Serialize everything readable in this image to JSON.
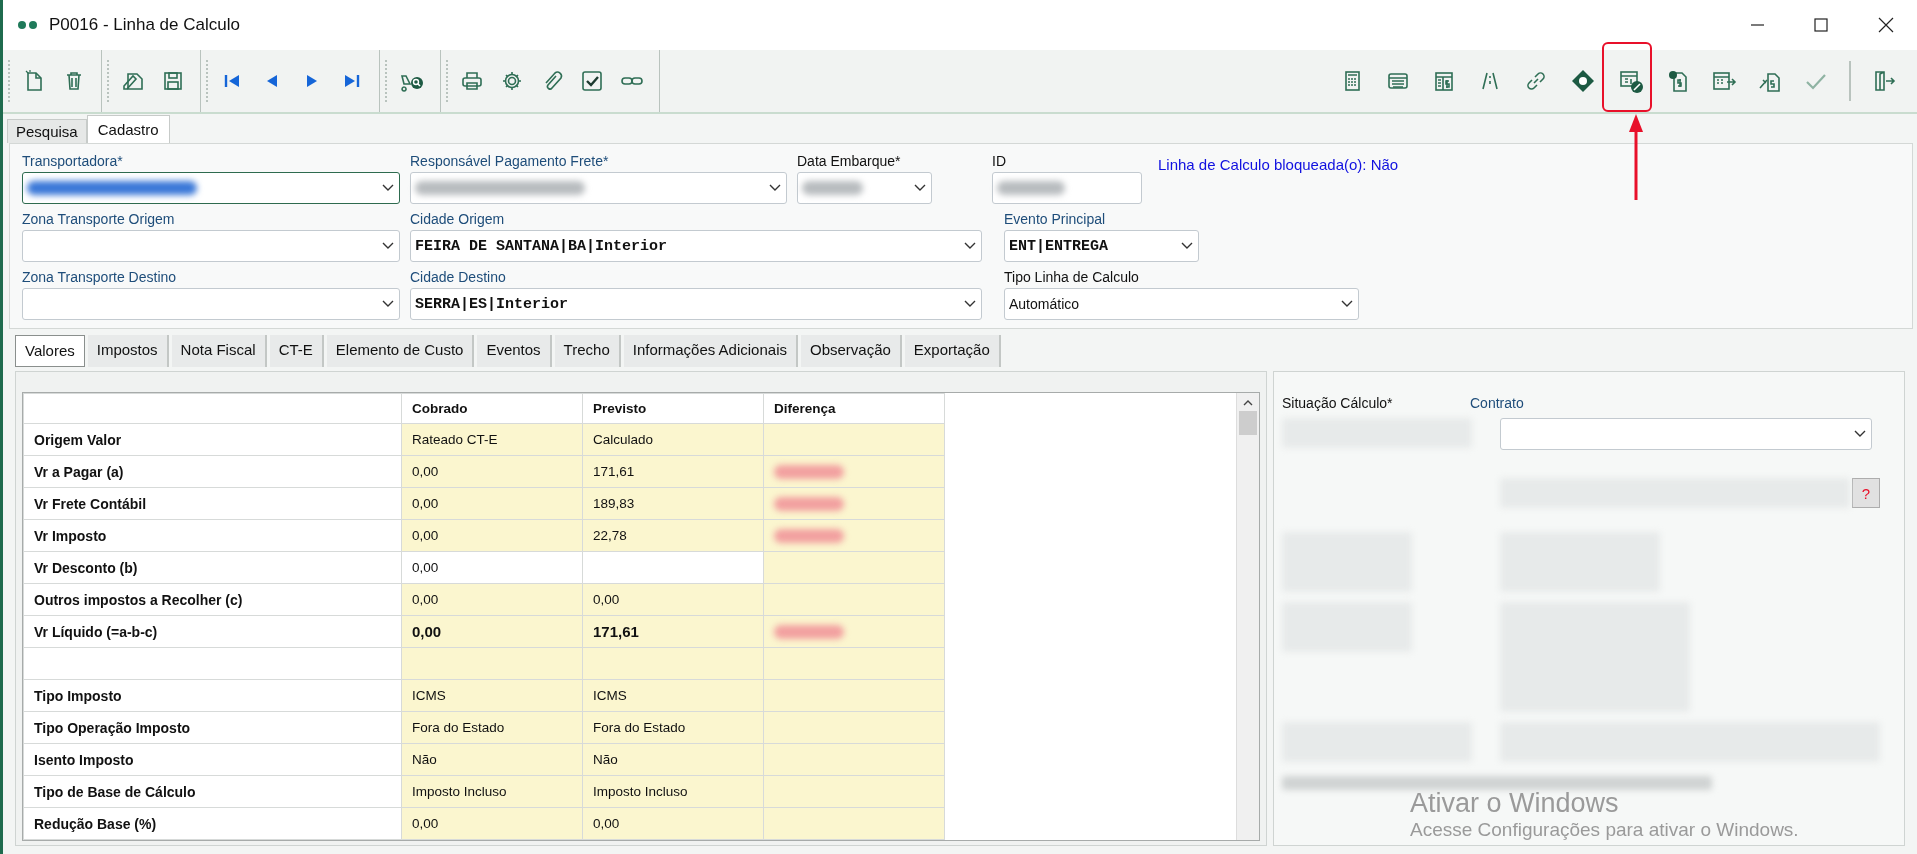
{
  "window": {
    "title": "P0016 - Linha de Calculo"
  },
  "page_tabs": [
    {
      "label": "Pesquisa",
      "selected": false
    },
    {
      "label": "Cadastro",
      "selected": true
    }
  ],
  "form": {
    "transportadora": {
      "label": "Transportadora*",
      "linked": true,
      "redacted": true,
      "focused": true
    },
    "responsavel": {
      "label": "Responsável Pagamento Frete*",
      "linked": true,
      "redacted": true,
      "focused": false
    },
    "data_embarque": {
      "label": "Data Embarque*",
      "linked": false,
      "redacted": true
    },
    "id": {
      "label": "ID",
      "linked": false,
      "redacted": true
    },
    "lock_status": "Linha de Calculo bloqueada(o): Não",
    "zona_origem": {
      "label": "Zona Transporte Origem",
      "linked": true
    },
    "cidade_origem": {
      "label": "Cidade Origem",
      "linked": true,
      "value": "FEIRA DE SANTANA|BA|Interior"
    },
    "evento_principal": {
      "label": "Evento Principal",
      "linked": true,
      "value": "ENT|ENTREGA"
    },
    "zona_destino": {
      "label": "Zona Transporte Destino",
      "linked": true
    },
    "cidade_destino": {
      "label": "Cidade Destino",
      "linked": true,
      "value": "SERRA|ES|Interior"
    },
    "tipo_linha": {
      "label": "Tipo Linha de Calculo",
      "linked": false,
      "value": "Automático"
    }
  },
  "detail_tabs": [
    {
      "label": "Valores",
      "selected": true
    },
    {
      "label": "Impostos",
      "selected": false
    },
    {
      "label": "Nota Fiscal",
      "selected": false
    },
    {
      "label": "CT-E",
      "selected": false
    },
    {
      "label": "Elemento de Custo",
      "selected": false
    },
    {
      "label": "Eventos",
      "selected": false
    },
    {
      "label": "Trecho",
      "selected": false
    },
    {
      "label": "Informações Adicionais",
      "selected": false
    },
    {
      "label": "Observação",
      "selected": false
    },
    {
      "label": "Exportação",
      "selected": false
    }
  ],
  "grid": {
    "columns": [
      "Cobrado",
      "Previsto",
      "Diferença"
    ],
    "rows": [
      {
        "kind": "values",
        "label": "Origem Valor",
        "cobrado": "Rateado CT-E",
        "previsto": "Calculado",
        "redacted": false,
        "bold": false,
        "editable": false
      },
      {
        "kind": "values",
        "label": "Vr a Pagar (a)",
        "cobrado": "0,00",
        "previsto": "171,61",
        "redacted": true,
        "bold": false,
        "editable": false
      },
      {
        "kind": "values",
        "label": "Vr Frete Contábil",
        "cobrado": "0,00",
        "previsto": "189,83",
        "redacted": true,
        "bold": false,
        "editable": false
      },
      {
        "kind": "values",
        "label": "Vr Imposto",
        "cobrado": "0,00",
        "previsto": "22,78",
        "redacted": true,
        "bold": false,
        "editable": false
      },
      {
        "kind": "values",
        "label": "Vr Desconto (b)",
        "cobrado": "0,00",
        "previsto": "",
        "redacted": false,
        "bold": false,
        "editable": true
      },
      {
        "kind": "values",
        "label": "Outros impostos a Recolher (c)",
        "cobrado": "0,00",
        "previsto": "0,00",
        "redacted": false,
        "bold": false,
        "editable": false
      },
      {
        "kind": "values",
        "label": "Vr Líquido (=a-b-c)",
        "cobrado": "0,00",
        "previsto": "171,61",
        "redacted": true,
        "bold": true,
        "editable": false
      },
      {
        "kind": "blank"
      },
      {
        "kind": "values",
        "label": "Tipo Imposto",
        "cobrado": "ICMS",
        "previsto": "ICMS",
        "redacted": false,
        "bold": false,
        "editable": false
      },
      {
        "kind": "values",
        "label": "Tipo Operação Imposto",
        "cobrado": "Fora do Estado",
        "previsto": "Fora do Estado",
        "redacted": false,
        "bold": false,
        "editable": false
      },
      {
        "kind": "values",
        "label": "Isento Imposto",
        "cobrado": "Não",
        "previsto": "Não",
        "redacted": false,
        "bold": false,
        "editable": false
      },
      {
        "kind": "values",
        "label": "Tipo de Base de Cálculo",
        "cobrado": "Imposto Incluso",
        "previsto": "Imposto Incluso",
        "redacted": false,
        "bold": false,
        "editable": false
      },
      {
        "kind": "values",
        "label": "Redução Base (%)",
        "cobrado": "0,00",
        "previsto": "0,00",
        "redacted": false,
        "bold": false,
        "editable": false
      }
    ]
  },
  "side_panel": {
    "situacao": {
      "label": "Situação Cálculo*"
    },
    "contrato": {
      "label": "Contrato"
    },
    "help_button": "?"
  },
  "os_notice": {
    "title": "Ativar o Windows",
    "text": "Acesse Configurações para ativar o Windows."
  }
}
